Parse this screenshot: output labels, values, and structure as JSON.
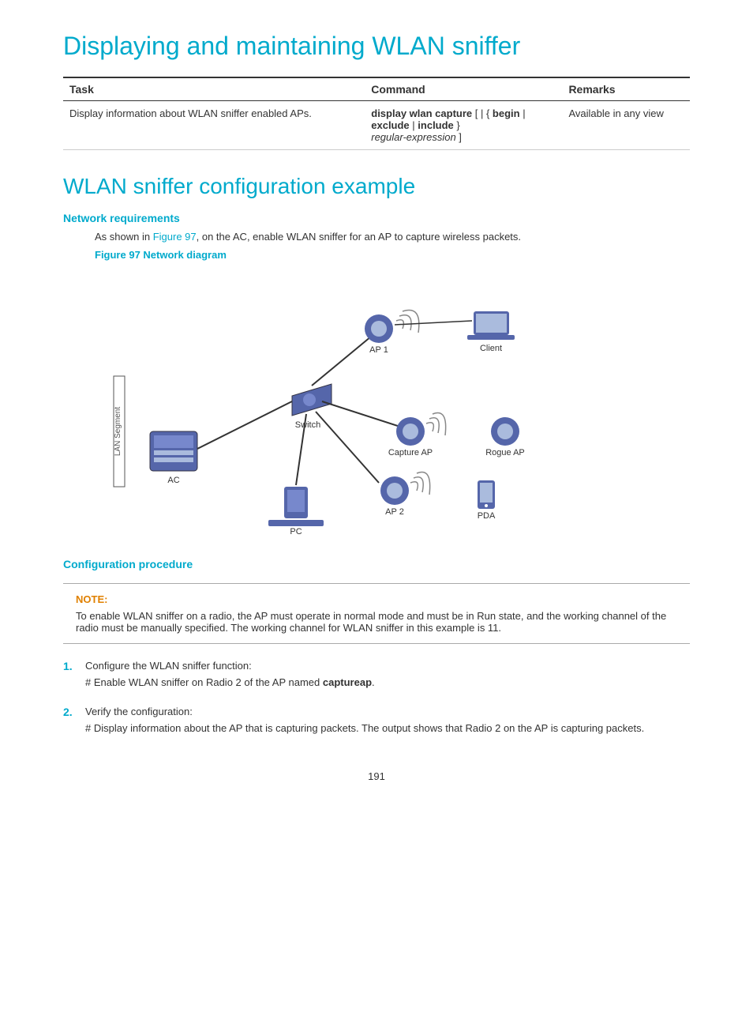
{
  "page": {
    "title1": "Displaying and maintaining WLAN sniffer",
    "title2": "WLAN sniffer configuration example",
    "section1_heading": "Network requirements",
    "section2_heading": "Configuration procedure",
    "figure_caption": "Figure 97 Network diagram",
    "intro_text": "As shown in Figure 97, on the AC, enable WLAN sniffer for an AP to capture wireless packets.",
    "note_label": "NOTE:",
    "note_text": "To enable WLAN sniffer on a radio, the AP must operate in normal mode and must be in Run state, and the working channel of the radio must be manually specified. The working channel for WLAN sniffer in this example is 11.",
    "step1_num": "1.",
    "step1_text": "Configure the WLAN sniffer function:",
    "step1_detail": "# Enable WLAN sniffer on Radio 2 of the AP named captureap.",
    "step1_bold": "captureap",
    "step2_num": "2.",
    "step2_text": "Verify the configuration:",
    "step2_detail": "# Display information about the AP that is capturing packets. The output shows that Radio 2 on the AP is capturing packets.",
    "page_number": "191",
    "table": {
      "headers": [
        "Task",
        "Command",
        "Remarks"
      ],
      "rows": [
        {
          "task": "Display information about WLAN sniffer enabled APs.",
          "command_parts": [
            {
              "text": "display wlan capture",
              "bold": true
            },
            {
              "text": " [ | { ",
              "bold": false
            },
            {
              "text": "begin",
              "bold": true
            },
            {
              "text": " |",
              "bold": false
            },
            {
              "text": "\nexclude",
              "bold": true
            },
            {
              "text": " | ",
              "bold": false
            },
            {
              "text": "include",
              "bold": true
            },
            {
              "text": " }",
              "bold": false
            },
            {
              "text": "\n",
              "bold": false
            },
            {
              "text": "regular-expression",
              "bold": false,
              "italic": true
            },
            {
              "text": " ]",
              "bold": false
            }
          ],
          "remarks": "Available in any view"
        }
      ]
    }
  }
}
